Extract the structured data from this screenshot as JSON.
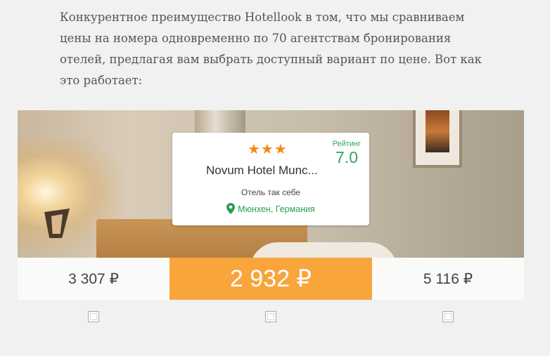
{
  "intro_text": "Конкурентное преимущество Hotellook в том, что мы сравниваем цены на номера одновременно по 70 агентствам бронирования отелей, предлагая вам выбрать доступный вариант по цене. Вот как это работает:",
  "hotel": {
    "stars": "★★★",
    "star_count": 3,
    "rating_label": "Рейтинг",
    "rating_value": "7.0",
    "name": "Novum Hotel Munc...",
    "description": "Отель так себе",
    "location": "Мюнхен, Германия"
  },
  "prices": {
    "left": "3 307 ₽",
    "best": "2 932 ₽",
    "right": "5 116 ₽"
  },
  "colors": {
    "accent": "#f8a53c",
    "rating_green": "#3aa35a",
    "location_green": "#2a9d50",
    "star_orange": "#f28a16"
  },
  "icons": {
    "location": "map-pin-icon",
    "star": "star-icon"
  }
}
